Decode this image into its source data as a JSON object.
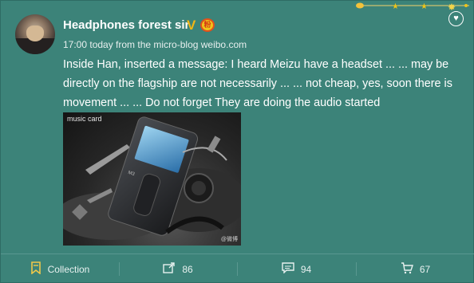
{
  "post": {
    "username": "Headphones forest sir",
    "verified_mark": "V",
    "fan_badge": "粉",
    "meta": "17:00 today from the micro-blog weibo.com",
    "text": "Inside Han, inserted a message: I heard Meizu have a headset ... ... may be directly on the flagship are not necessarily ... ... not cheap, yes, soon there is movement ... ... Do not forget They are doing the audio started",
    "image": {
      "label": "music card",
      "watermark": "@微博"
    }
  },
  "footer": {
    "collection_label": "Collection",
    "repost_count": "86",
    "comment_count": "94",
    "like_count": "67"
  },
  "colors": {
    "background": "#3c8379",
    "text": "#ffffff",
    "badge": "#f0c419"
  }
}
